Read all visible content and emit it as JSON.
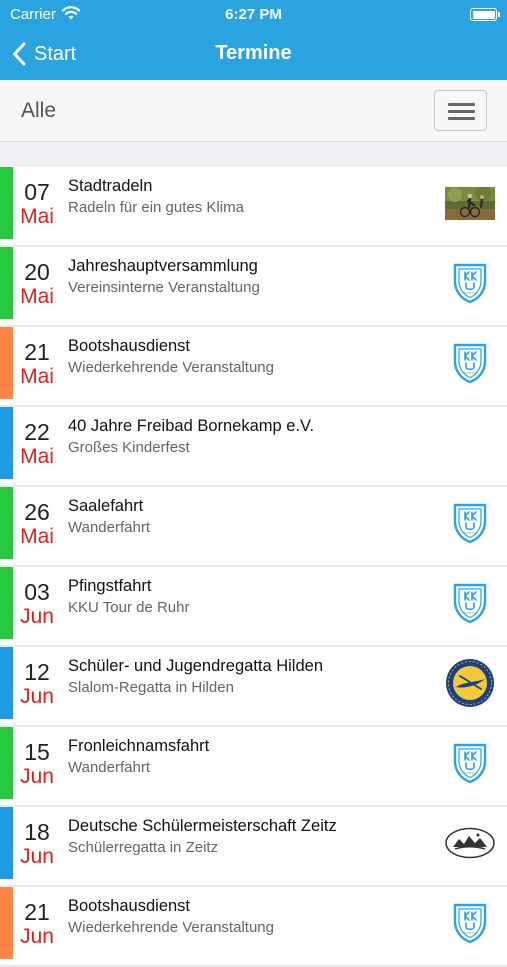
{
  "status_bar": {
    "carrier": "Carrier",
    "time": "6:27 PM"
  },
  "nav": {
    "back_label": "Start",
    "title": "Termine"
  },
  "filter": {
    "label": "Alle"
  },
  "colors": {
    "accent": "#2aa4e0",
    "green": "#27c940",
    "orange": "#ff8446",
    "blue": "#1f9be0",
    "month_red": "#e0211f"
  },
  "events": [
    {
      "day": "07",
      "month": "Mai",
      "title": "Stadtradeln",
      "subtitle": "Radeln für ein gutes Klima",
      "bar_color": "#27c940",
      "logo": "photo"
    },
    {
      "day": "20",
      "month": "Mai",
      "title": "Jahreshauptversammlung",
      "subtitle": "Vereinsinterne Veranstaltung",
      "bar_color": "#27c940",
      "logo": "kku-shield"
    },
    {
      "day": "21",
      "month": "Mai",
      "title": "Bootshausdienst",
      "subtitle": "Wiederkehrende Veranstaltung",
      "bar_color": "#ff8446",
      "logo": "kku-shield"
    },
    {
      "day": "22",
      "month": "Mai",
      "title": "40 Jahre Freibad Bornekamp e.V.",
      "subtitle": "Großes Kinderfest",
      "bar_color": "#1f9be0",
      "logo": "none"
    },
    {
      "day": "26",
      "month": "Mai",
      "title": "Saalefahrt",
      "subtitle": "Wanderfahrt",
      "bar_color": "#27c940",
      "logo": "kku-shield"
    },
    {
      "day": "03",
      "month": "Jun",
      "title": "Pfingstfahrt",
      "subtitle": "KKU Tour de Ruhr",
      "bar_color": "#27c940",
      "logo": "kku-shield"
    },
    {
      "day": "12",
      "month": "Jun",
      "title": "Schüler- und Jugendregatta Hilden",
      "subtitle": "Slalom-Regatta in Hilden",
      "bar_color": "#1f9be0",
      "logo": "kanu-club-hilden"
    },
    {
      "day": "15",
      "month": "Jun",
      "title": "Fronleichnamsfahrt",
      "subtitle": "Wanderfahrt",
      "bar_color": "#27c940",
      "logo": "kku-shield"
    },
    {
      "day": "18",
      "month": "Jun",
      "title": "Deutsche Schülermeisterschaft Zeitz",
      "subtitle": "Schülerregatta in Zeitz",
      "bar_color": "#1f9be0",
      "logo": "zeitz-emblem"
    },
    {
      "day": "21",
      "month": "Jun",
      "title": "Bootshausdienst",
      "subtitle": "Wiederkehrende Veranstaltung",
      "bar_color": "#ff8446",
      "logo": "kku-shield"
    }
  ]
}
